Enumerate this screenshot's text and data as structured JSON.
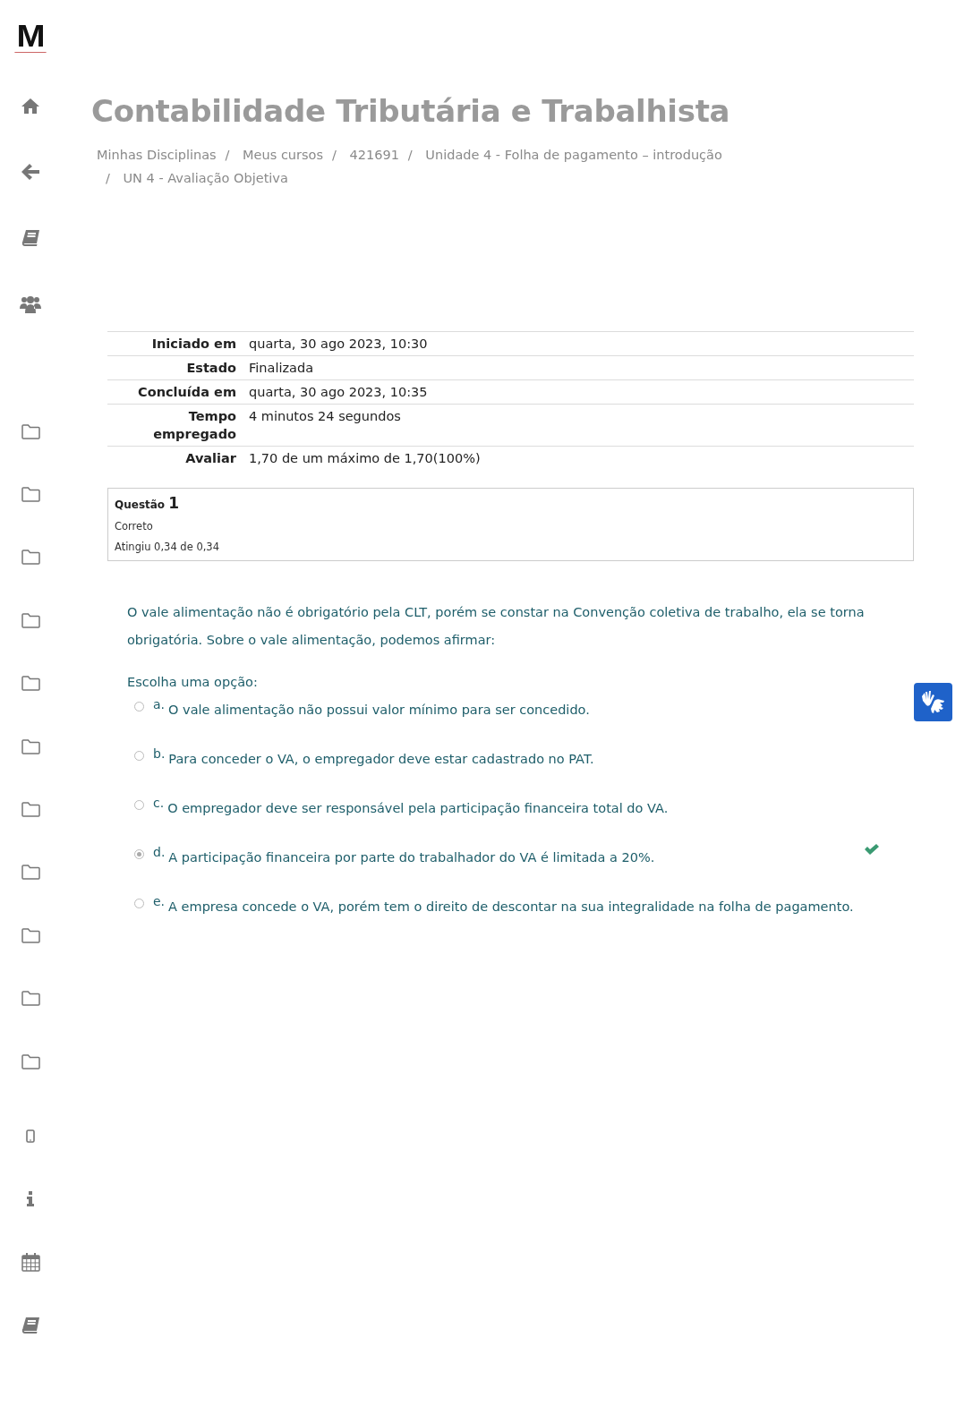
{
  "logo": {
    "text": "M"
  },
  "sidebar": {
    "groups": [
      {
        "items": [
          {
            "kind": "home"
          },
          {
            "kind": "back"
          },
          {
            "kind": "book"
          },
          {
            "kind": "users"
          }
        ]
      },
      {
        "items": [
          {
            "kind": "folder"
          },
          {
            "kind": "folder"
          },
          {
            "kind": "folder"
          },
          {
            "kind": "folder"
          },
          {
            "kind": "folder"
          },
          {
            "kind": "folder"
          },
          {
            "kind": "folder"
          },
          {
            "kind": "folder"
          },
          {
            "kind": "folder"
          },
          {
            "kind": "folder"
          },
          {
            "kind": "folder"
          }
        ]
      },
      {
        "items": [
          {
            "kind": "device"
          },
          {
            "kind": "info"
          },
          {
            "kind": "calendar"
          },
          {
            "kind": "book"
          }
        ]
      }
    ]
  },
  "page_title": "Contabilidade Tributária e Trabalhista",
  "breadcrumb_separator": "/",
  "breadcrumb": [
    "Minhas Disciplinas",
    "Meus cursos",
    "421691",
    "Unidade 4 - Folha de pagamento – introdução",
    "UN 4 - Avaliação Objetiva"
  ],
  "summary": [
    {
      "label": "Iniciado em",
      "value": "quarta, 30 ago 2023, 10:30"
    },
    {
      "label": "Estado",
      "value": "Finalizada"
    },
    {
      "label": "Concluída em",
      "value": "quarta, 30 ago 2023, 10:35"
    },
    {
      "label": "Tempo empregado",
      "value": "4 minutos 24 segundos"
    },
    {
      "label": "Avaliar",
      "value": "1,70 de um máximo de 1,70(100%)"
    }
  ],
  "question": {
    "label": "Questão",
    "number": "1",
    "status": "Correto",
    "grade": "Atingiu 0,34 de 0,34",
    "text": "O vale alimentação não é obrigatório pela CLT, porém se constar na Convenção coletiva de trabalho, ela se torna obrigatória. Sobre o vale alimentação, podemos afirmar:",
    "prompt": "Escolha uma opção:",
    "options": [
      {
        "letter": "a.",
        "text": "O vale alimentação não possui valor mínimo para ser concedido.",
        "selected": false,
        "correct": false
      },
      {
        "letter": "b.",
        "text": "Para conceder o VA, o empregador deve estar cadastrado no PAT.",
        "selected": false,
        "correct": false
      },
      {
        "letter": "c.",
        "text": "O empregador deve ser responsável pela participação financeira total do VA.",
        "selected": false,
        "correct": false
      },
      {
        "letter": "d.",
        "text": "A participação financeira por parte do trabalhador do VA é limitada a 20%.",
        "selected": true,
        "correct": true
      },
      {
        "letter": "e.",
        "text": "A empresa concede o VA, porém tem o direito de descontar na sua integralidade na folha de pagamento.",
        "selected": false,
        "correct": false
      }
    ]
  }
}
